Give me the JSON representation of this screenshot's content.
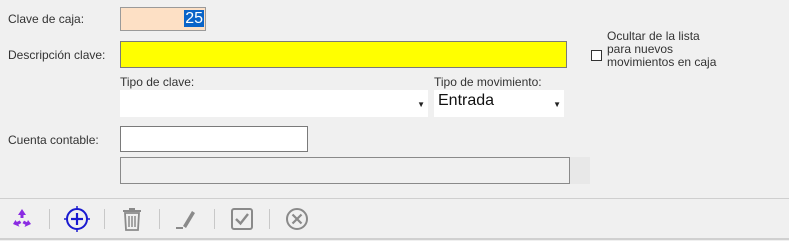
{
  "form": {
    "code_label": "Clave de caja:",
    "code_value": "25",
    "description_label": "Descripción clave:",
    "description_value": "",
    "key_type_label": "Tipo de clave:",
    "key_type_value": "",
    "movement_type_label": "Tipo de movimiento:",
    "movement_type_value": "Entrada",
    "account_label": "Cuenta contable:",
    "account_value": "",
    "account_description_value": "",
    "hide_checkbox_label": "Ocultar de la lista para nuevos movimientos en caja",
    "hide_checkbox_checked": false
  },
  "toolbar": {
    "icons": [
      "recycle-icon",
      "add-circle-icon",
      "trash-icon",
      "edit-pencil-icon",
      "checkmark-icon",
      "cancel-circle-icon"
    ]
  },
  "colors": {
    "code_field_bg": "#fde0c5",
    "description_field_bg": "#ffff00",
    "selection": "#0a64c8",
    "recycle_icon": "#8a2be2",
    "add_icon": "#1a1ad0"
  }
}
